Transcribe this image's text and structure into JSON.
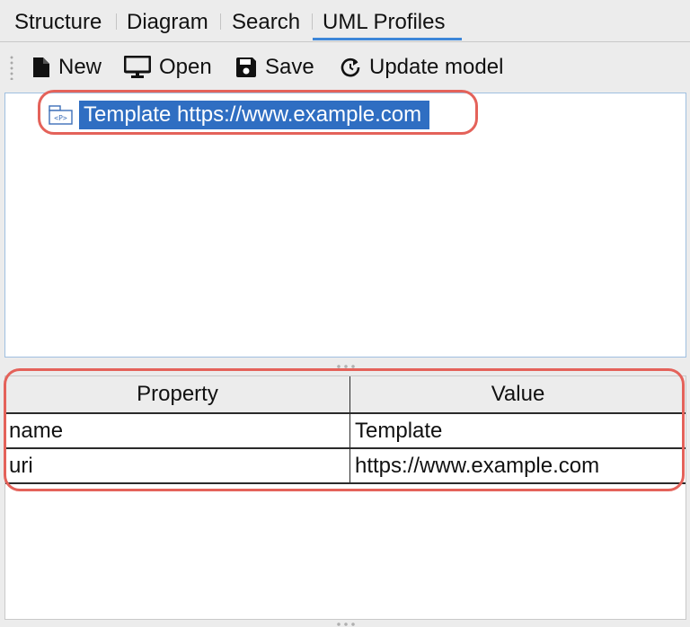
{
  "tabs": [
    {
      "label": "Structure",
      "active": false
    },
    {
      "label": "Diagram",
      "active": false
    },
    {
      "label": "Search",
      "active": false
    },
    {
      "label": "UML Profiles",
      "active": true
    }
  ],
  "toolbar": {
    "new_label": "New",
    "open_label": "Open",
    "save_label": "Save",
    "update_label": "Update model",
    "icons": [
      "document-icon",
      "monitor-icon",
      "floppy-disk-icon",
      "refresh-icon"
    ]
  },
  "tree": {
    "items": [
      {
        "label": "Template https://www.example.com",
        "icon": "profile-package-icon",
        "selected": true
      }
    ]
  },
  "properties": {
    "headers": {
      "property": "Property",
      "value": "Value"
    },
    "rows": [
      {
        "property": "name",
        "value": "Template"
      },
      {
        "property": "uri",
        "value": "https://www.example.com"
      }
    ]
  },
  "colors": {
    "accent": "#3d86d8",
    "selection": "#2f6ec2",
    "highlight": "#e4625a"
  }
}
